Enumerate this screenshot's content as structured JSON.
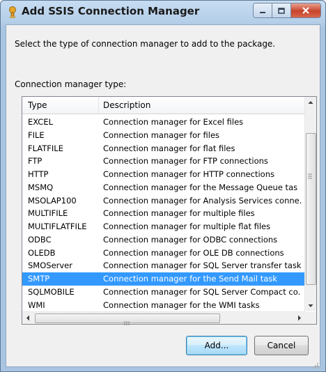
{
  "window": {
    "title": "Add SSIS Connection Manager"
  },
  "dialog": {
    "instruction": "Select the type of connection manager to add to the package.",
    "list_label": "Connection manager type:"
  },
  "listview": {
    "columns": [
      "Type",
      "Description"
    ],
    "rows": [
      {
        "type": "EXCEL",
        "description": "Connection manager for Excel files"
      },
      {
        "type": "FILE",
        "description": "Connection manager for files"
      },
      {
        "type": "FLATFILE",
        "description": "Connection manager for flat files"
      },
      {
        "type": "FTP",
        "description": "Connection manager for FTP connections"
      },
      {
        "type": "HTTP",
        "description": "Connection manager for HTTP connections"
      },
      {
        "type": "MSMQ",
        "description": "Connection manager for the Message Queue tas"
      },
      {
        "type": "MSOLAP100",
        "description": "Connection manager for Analysis Services conne."
      },
      {
        "type": "MULTIFILE",
        "description": "Connection manager for multiple files"
      },
      {
        "type": "MULTIFLATFILE",
        "description": "Connection manager for multiple flat files"
      },
      {
        "type": "ODBC",
        "description": "Connection manager for ODBC connections"
      },
      {
        "type": "OLEDB",
        "description": "Connection manager for OLE DB connections"
      },
      {
        "type": "SMOServer",
        "description": "Connection manager for SQL Server transfer task"
      },
      {
        "type": "SMTP",
        "description": "Connection manager for the Send Mail task"
      },
      {
        "type": "SQLMOBILE",
        "description": "Connection manager for SQL Server Compact co."
      },
      {
        "type": "WMI",
        "description": "Connection manager for the WMI tasks"
      }
    ],
    "selected_index": 12
  },
  "buttons": {
    "add": "Add...",
    "cancel": "Cancel"
  },
  "colors": {
    "selection": "#3399ff",
    "title_bar": "#b5cfe9",
    "close_button": "#c7442c"
  },
  "icons": {
    "title": "ssis-connection-icon",
    "minimize": "minimize-icon",
    "maximize": "maximize-icon",
    "close": "close-icon"
  }
}
